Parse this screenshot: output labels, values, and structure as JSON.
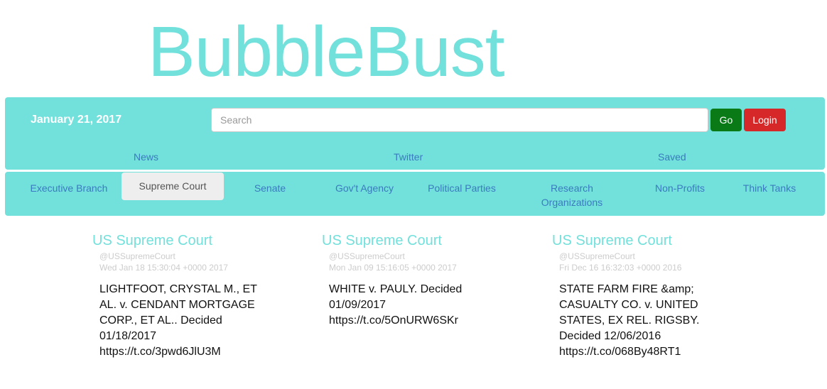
{
  "brand": {
    "title": "BubbleBust",
    "colors": {
      "accent": "#72e0db",
      "link": "#3a7bbf",
      "go": "#0a7a17",
      "login": "#d62828"
    }
  },
  "header": {
    "date": "January 21, 2017",
    "search_placeholder": "Search",
    "go_label": "Go",
    "login_label": "Login"
  },
  "main_nav": [
    {
      "label": "News"
    },
    {
      "label": "Twitter"
    },
    {
      "label": "Saved"
    }
  ],
  "categories": [
    {
      "label": "Executive Branch",
      "active": false
    },
    {
      "label": "Supreme Court",
      "active": true
    },
    {
      "label": "Senate",
      "active": false
    },
    {
      "label": "Gov't Agency",
      "active": false
    },
    {
      "label": "Political Parties",
      "active": false
    },
    {
      "label": "Research Organizations",
      "active": false
    },
    {
      "label": "Non-Profits",
      "active": false
    },
    {
      "label": "Think Tanks",
      "active": false
    }
  ],
  "tweets": [
    {
      "name": "US Supreme Court",
      "handle": "@USSupremeCourt",
      "time": "Wed Jan 18 15:30:04 +0000 2017",
      "text": "LIGHTFOOT, CRYSTAL M., ET AL. v. CENDANT MORTGAGE CORP., ET AL.. Decided 01/18/2017 https://t.co/3pwd6JlU3M"
    },
    {
      "name": "US Supreme Court",
      "handle": "@USSupremeCourt",
      "time": "Mon Jan 09 15:16:05 +0000 2017",
      "text": "WHITE v. PAULY. Decided 01/09/2017 https://t.co/5OnURW6SKr"
    },
    {
      "name": "US Supreme Court",
      "handle": "@USSupremeCourt",
      "time": "Fri Dec 16 16:32:03 +0000 2016",
      "text": "STATE FARM FIRE &amp; CASUALTY CO. v. UNITED STATES, EX REL. RIGSBY. Decided 12/06/2016 https://t.co/068By48RT1"
    }
  ]
}
